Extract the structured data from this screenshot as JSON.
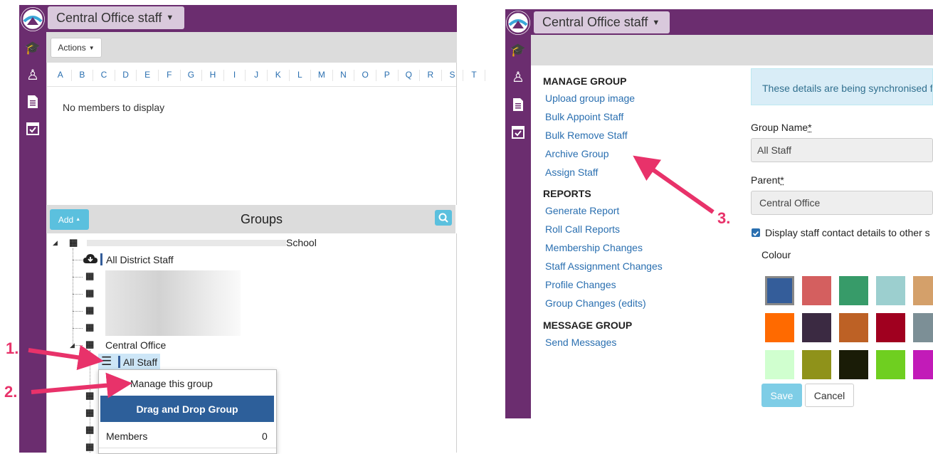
{
  "left_screen": {
    "title": "Central Office staff",
    "actions_label": "Actions",
    "alphabet": [
      "A",
      "B",
      "C",
      "D",
      "E",
      "F",
      "G",
      "H",
      "I",
      "J",
      "K",
      "L",
      "M",
      "N",
      "O",
      "P",
      "Q",
      "R",
      "S",
      "T"
    ],
    "empty_message": "No members to display",
    "groups_title": "Groups",
    "add_label": "Add",
    "tree": {
      "school_suffix": "School",
      "district": "All District Staff",
      "central_office": "Central Office",
      "all_staff": "All Staff"
    },
    "context_menu": {
      "manage": "Manage this group",
      "drag_drop": "Drag and Drop Group",
      "members_label": "Members",
      "members_count": "0"
    }
  },
  "right_screen": {
    "title": "Central Office staff",
    "sections": {
      "manage_group": "MANAGE GROUP",
      "reports": "REPORTS",
      "message_group": "MESSAGE GROUP"
    },
    "manage_links": [
      "Upload group image",
      "Bulk Appoint Staff",
      "Bulk Remove Staff",
      "Archive Group",
      "Assign Staff"
    ],
    "report_links": [
      "Generate Report",
      "Roll Call Reports",
      "Membership Changes",
      "Staff Assignment Changes",
      "Profile Changes",
      "Group Changes (edits)"
    ],
    "message_links": [
      "Send Messages"
    ],
    "info_text": "These details are being synchronised f",
    "group_name_label": "Group Name",
    "group_name_value": "All Staff",
    "parent_label": "Parent",
    "parent_value": "Central Office",
    "checkbox_label": "Display staff contact details to other s",
    "colour_label": "Colour",
    "save_label": "Save",
    "cancel_label": "Cancel",
    "colours": [
      "#345d9a",
      "#d45f5f",
      "#379b69",
      "#9ccfcf",
      "#d4a06a",
      "#ff6a00",
      "#3b2a42",
      "#bd6125",
      "#a0001f",
      "#7c8f96",
      "#d0ffcf",
      "#8f921a",
      "#1a1c07",
      "#6fcf20",
      "#c21bb8"
    ]
  },
  "annotations": {
    "step1": "1.",
    "step2": "2.",
    "step3": "3."
  },
  "colors": {
    "purple": "#6b2d6f",
    "accent": "#5bc0de",
    "link": "#2a6fb0",
    "arrow": "#e8326a"
  }
}
